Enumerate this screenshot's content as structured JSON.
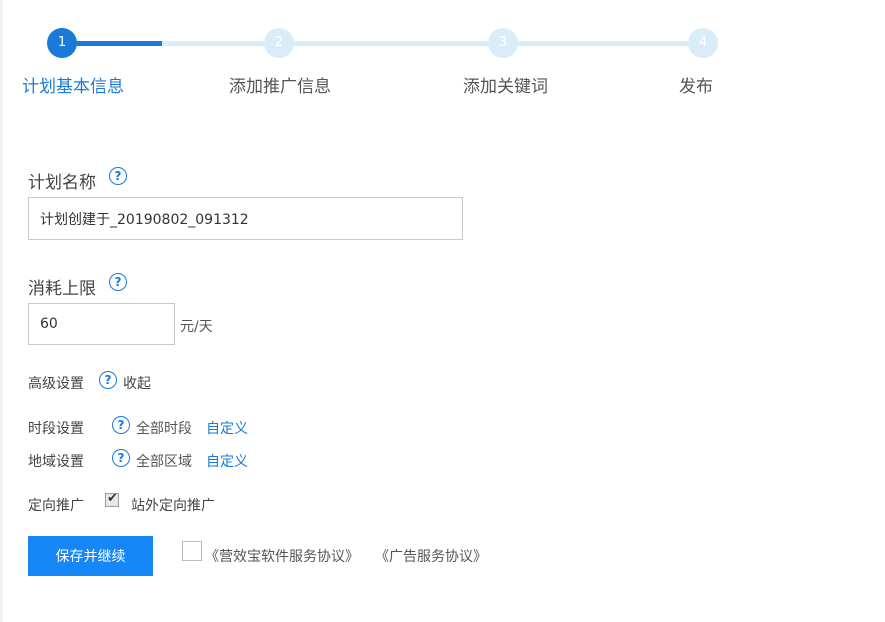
{
  "stepper": {
    "steps": [
      {
        "number": "1",
        "label": "计划基本信息",
        "state": "active"
      },
      {
        "number": "2",
        "label": "添加推广信息",
        "state": "pending"
      },
      {
        "number": "3",
        "label": "添加关键词",
        "state": "pending"
      },
      {
        "number": "4",
        "label": "发布",
        "state": "pending"
      }
    ],
    "colors": {
      "active": "#1a7ad9",
      "pending": "#d9ecf8"
    }
  },
  "form": {
    "plan_name": {
      "label": "计划名称",
      "help_icon": "question-circle-icon",
      "value": "计划创建于_20190802_091312"
    },
    "budget": {
      "label": "消耗上限",
      "help_icon": "question-circle-icon",
      "value": "60",
      "unit": "元/天"
    },
    "advanced": {
      "label": "高级设置",
      "help_icon": "question-circle-icon",
      "toggle": "收起"
    },
    "time_setting": {
      "label": "时段设置",
      "help_icon": "question-circle-icon",
      "value": "全部时段",
      "link": "自定义"
    },
    "region_setting": {
      "label": "地域设置",
      "help_icon": "question-circle-icon",
      "value": "全部区域",
      "link": "自定义"
    },
    "targeting": {
      "label": "定向推广",
      "checkbox_checked": true,
      "option": "站外定向推广"
    }
  },
  "footer": {
    "save_button": "保存并继续",
    "agreement_checked": false,
    "agreement_1": "《营效宝软件服务协议》",
    "agreement_2": "《广告服务协议》"
  }
}
